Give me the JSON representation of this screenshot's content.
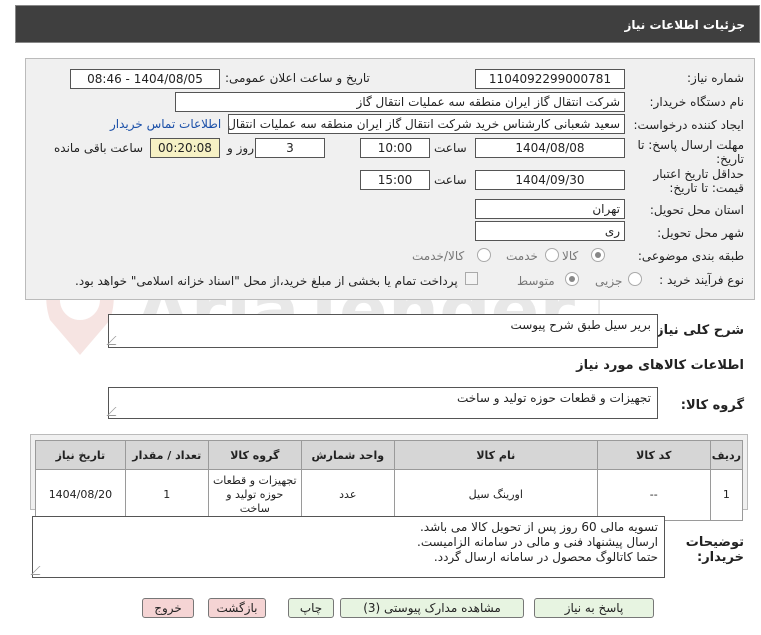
{
  "header": {
    "title": "جزئیات اطلاعات نیاز"
  },
  "fields": {
    "need_number_label": "شماره نیاز:",
    "need_number": "1104092299000781",
    "announce_label": "تاریخ و ساعت اعلان عمومی:",
    "announce_value": "1404/08/05 - 08:46",
    "buyer_org_label": "نام دستگاه خریدار:",
    "buyer_org": "شرکت انتقال گاز ایران منطقه سه عملیات انتقال گاز",
    "creator_label": "ایجاد کننده درخواست:",
    "creator": "سعید شعبانی کارشناس خرید شرکت انتقال گاز ایران منطقه سه عملیات انتقال",
    "contact_link": "اطلاعات تماس خریدار",
    "deadline_label_1": "مهلت ارسال پاسخ: تا",
    "deadline_label_2": "تاریخ:",
    "deadline_date": "1404/08/08",
    "time_label": "ساعت",
    "deadline_time": "10:00",
    "days_value": "3",
    "days_label": "روز و",
    "remaining_time": "00:20:08",
    "remaining_label": "ساعت باقی مانده",
    "validity_label_1": "حداقل تاریخ اعتبار",
    "validity_label_2": "قیمت: تا تاریخ:",
    "validity_date": "1404/09/30",
    "validity_time": "15:00",
    "province_label": "استان محل تحویل:",
    "province": "تهران",
    "city_label": "شهر محل تحویل:",
    "city": "ری",
    "category_label": "طبقه بندی موضوعی:",
    "category_options": [
      "کالا",
      "خدمت",
      "کالا/خدمت"
    ],
    "purchase_type_label": "نوع فرآیند خرید :",
    "purchase_options": [
      "جزیی",
      "متوسط"
    ],
    "payment_note": "پرداخت تمام یا بخشی از مبلغ خرید،از محل \"اسناد خزانه اسلامی\" خواهد بود."
  },
  "description": {
    "label": "شرح کلی نیاز:",
    "value": "بریر سیل طبق شرح پیوست"
  },
  "goods_info": {
    "title": "اطلاعات کالاهای مورد نیاز"
  },
  "goods_group": {
    "label": "گروه کالا:",
    "value": "تجهیزات و قطعات حوزه تولید و ساخت"
  },
  "table": {
    "headers": [
      "ردیف",
      "کد کالا",
      "نام کالا",
      "واحد شمارش",
      "گروه کالا",
      "تعداد / مقدار",
      "تاریخ نیاز"
    ],
    "rows": [
      [
        "1",
        "--",
        "اورینگ سیل",
        "عدد",
        "تجهیزات و قطعات حوزه تولید و ساخت",
        "1",
        "1404/08/20"
      ]
    ]
  },
  "buyer_notes": {
    "label_1": "توضیحات",
    "label_2": "خریدار:",
    "lines": [
      "تسویه مالی 60 روز پس از تحویل کالا می باشد.",
      "ارسال پیشنهاد فنی و مالی در سامانه الزامیست.",
      "حتما کاتالوگ محصول در سامانه ارسال گردد."
    ]
  },
  "buttons": {
    "reply": "پاسخ به نیاز",
    "view_docs": "مشاهده مدارک پیوستی (3)",
    "print": "چاپ",
    "back": "بازگشت",
    "exit": "خروج"
  },
  "watermark": "AriaTender.net",
  "colors": {
    "header_bg": "#3f3f3f",
    "link": "#1a4fa8",
    "remaining_bg": "#f6f1c5",
    "button_green": "#e7f4e1",
    "button_pink": "#f5d4d4"
  }
}
